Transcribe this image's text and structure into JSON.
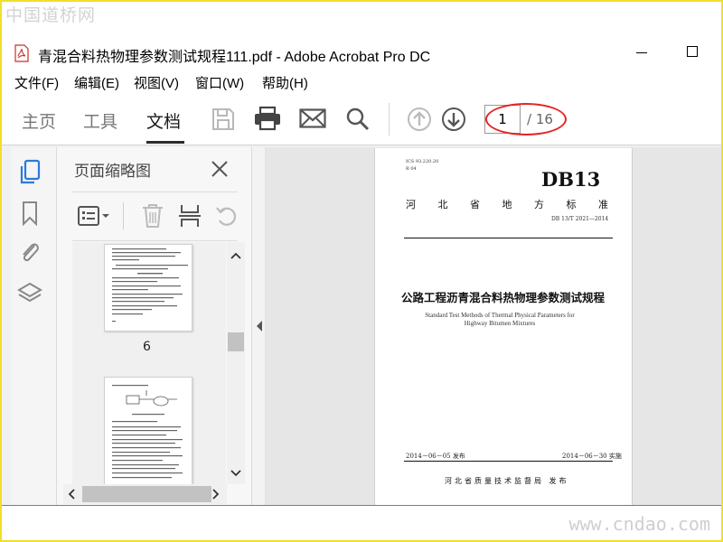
{
  "watermark": {
    "top": "中国道桥网",
    "bottom": "www.cndao.com"
  },
  "window": {
    "title": "青混合料热物理参数测试规程111.pdf - Adobe Acrobat Pro DC"
  },
  "menu": [
    "文件(F)",
    "编辑(E)",
    "视图(V)",
    "窗口(W)",
    "帮助(H)"
  ],
  "tabs": {
    "home": "主页",
    "tools": "工具",
    "document": "文档"
  },
  "pager": {
    "current": "1",
    "total": "/ 16"
  },
  "panel": {
    "title": "页面缩略图",
    "thumbs": [
      {
        "label": "6"
      }
    ]
  },
  "page": {
    "ics": "ICS 93.220.20",
    "cls": "R 04",
    "code": "DB13",
    "org_chars": [
      "河",
      "北",
      "省",
      "地",
      "方",
      "标",
      "准"
    ],
    "std_no": "DB 13/T 2021—2014",
    "title": "公路工程沥青混合料热物理参数测试规程",
    "title_en_1": "Standard Test Methods of Thermal Physical Parameters for",
    "title_en_2": "Highway Bitumen Mixtures",
    "date_pub": "2014－06－05 发布",
    "date_eff": "2014－06－30 实施",
    "issuer": "河北省质量技术监督局  发布"
  },
  "colors": {
    "accent": "#2b7ad9",
    "frame": "#f2de2c",
    "highlight_ring": "#e42424"
  }
}
